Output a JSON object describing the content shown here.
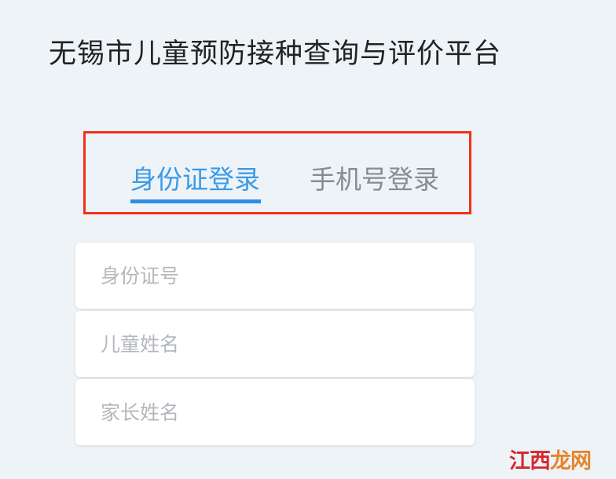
{
  "header": {
    "title": "无锡市儿童预防接种查询与评价平台"
  },
  "tabs": [
    {
      "label": "身份证登录",
      "active": true
    },
    {
      "label": "手机号登录",
      "active": false
    }
  ],
  "form": {
    "fields": [
      {
        "placeholder": "身份证号",
        "value": ""
      },
      {
        "placeholder": "儿童姓名",
        "value": ""
      },
      {
        "placeholder": "家长姓名",
        "value": ""
      }
    ]
  },
  "watermark": {
    "text_a": "江西",
    "text_b": "龙网"
  },
  "colors": {
    "background": "#eef3f8",
    "active_tab": "#3a9ae6",
    "inactive_tab": "#888c91",
    "highlight_border": "#f2311b"
  }
}
